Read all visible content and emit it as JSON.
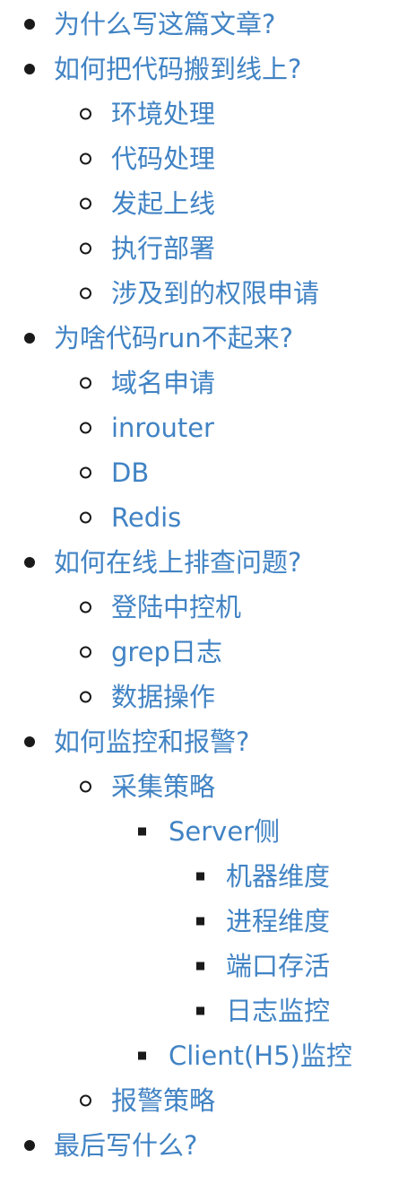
{
  "toc": [
    {
      "text": "为什么写这篇文章?"
    },
    {
      "text": "如何把代码搬到线上?"
    },
    {
      "text": "环境处理"
    },
    {
      "text": "代码处理"
    },
    {
      "text": "发起上线"
    },
    {
      "text": "执行部署"
    },
    {
      "text": "涉及到的权限申请"
    },
    {
      "text": "为啥代码run不起来?"
    },
    {
      "text": "域名申请"
    },
    {
      "text": "inrouter"
    },
    {
      "text": "DB"
    },
    {
      "text": "Redis"
    },
    {
      "text": "如何在线上排查问题?"
    },
    {
      "text": "登陆中控机"
    },
    {
      "text": "grep日志"
    },
    {
      "text": "数据操作"
    },
    {
      "text": "如何监控和报警?"
    },
    {
      "text": "采集策略"
    },
    {
      "text": "Server侧"
    },
    {
      "text": "机器维度"
    },
    {
      "text": "进程维度"
    },
    {
      "text": "端口存活"
    },
    {
      "text": "日志监控"
    },
    {
      "text": "Client(H5)监控"
    },
    {
      "text": "报警策略"
    },
    {
      "text": "最后写什么?"
    }
  ]
}
